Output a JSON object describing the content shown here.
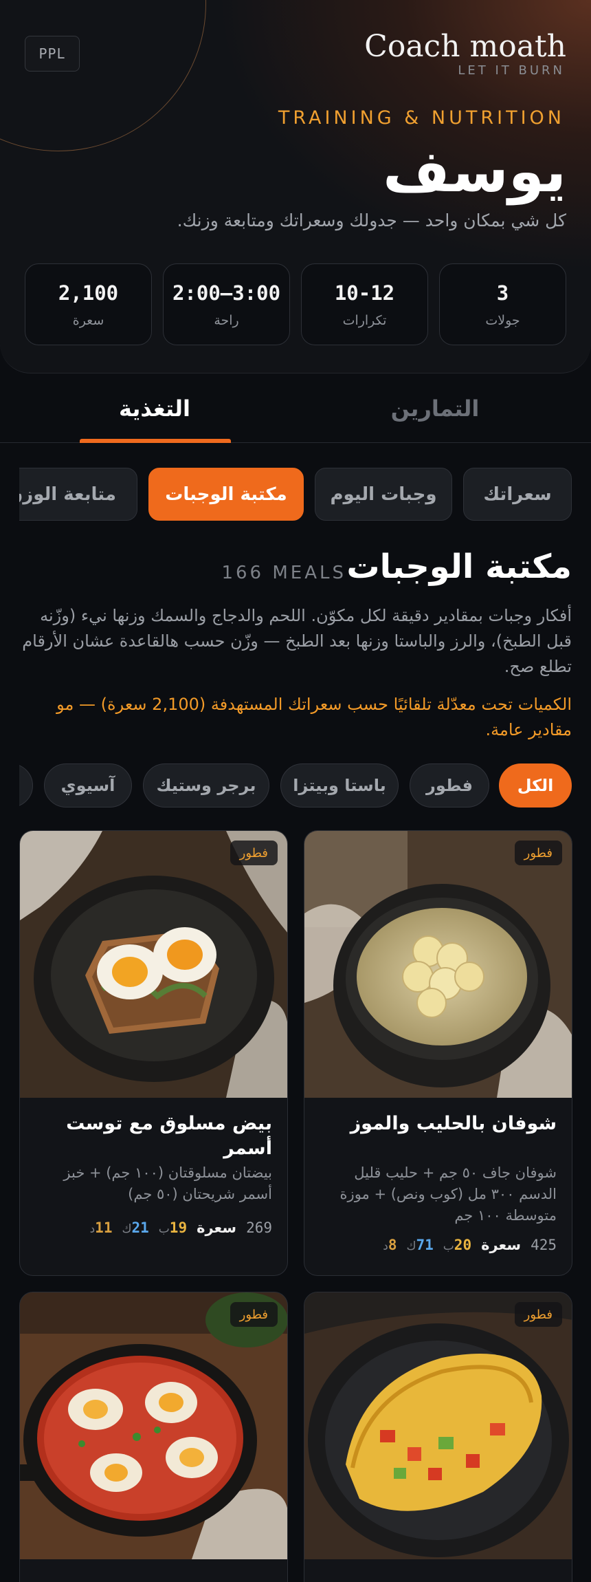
{
  "hero": {
    "badge": "PPL",
    "brand_title": "Coach moath",
    "brand_subtitle": "LET IT BURN",
    "kicker": "TRAINING & NUTRITION",
    "name": "يوسف",
    "description": "كل شي بمكان واحد — جدولك وسعراتك ومتابعة وزنك.",
    "stats": [
      {
        "value": "3",
        "label": "جولات"
      },
      {
        "value": "10-12",
        "label": "تكرارات"
      },
      {
        "value": "2:00–3:00",
        "label": "راحة"
      },
      {
        "value": "2,100",
        "label": "سعرة"
      }
    ]
  },
  "main_tabs": {
    "workouts": "التمارين",
    "nutrition": "التغذية",
    "active": "nutrition"
  },
  "sub_tabs": [
    "سعراتك",
    "وجبات اليوم",
    "مكتبة الوجبات",
    "متابعة الوزن"
  ],
  "library": {
    "title": "مكتبة الوجبات",
    "count": "166 MEALS",
    "description": "أفكار وجبات بمقادير دقيقة لكل مكوّن. اللحم والدجاج والسمك وزنها نيء (وزّنه قبل الطبخ)، والرز والباستا وزنها بعد الطبخ — وزّن حسب هالقاعدة عشان الأرقام تطلع صح.",
    "note": "الكميات تحت معدّلة تلقائيًا حسب سعراتك المستهدفة (2,100 سعرة) — مو مقادير عامة."
  },
  "filters": [
    "الكل",
    "فطور",
    "باستا وبيتزا",
    "برجر وستيك",
    "آسيوي"
  ],
  "macro_labels": {
    "kcal": "سعرة",
    "protein": "ب",
    "carbs": "ك",
    "fat": "د"
  },
  "meals": [
    {
      "category": "فطور",
      "name": "شوفان بالحليب والموز",
      "ingredients": "شوفان جاف ٥٠ جم + حليب قليل الدسم ٣٠٠ مل (كوب ونص) + موزة متوسطة ١٠٠ جم",
      "kcal": "425",
      "protein": "20",
      "carbs": "71",
      "fat": "8"
    },
    {
      "category": "فطور",
      "name": "بيض مسلوق مع توست أسمر",
      "ingredients": "بيضتان مسلوقتان (١٠٠ جم) + خبز أسمر شريحتان (٥٠ جم)",
      "kcal": "269",
      "protein": "19",
      "carbs": "21",
      "fat": "11"
    },
    {
      "category": "فطور"
    },
    {
      "category": "فطور"
    }
  ]
}
